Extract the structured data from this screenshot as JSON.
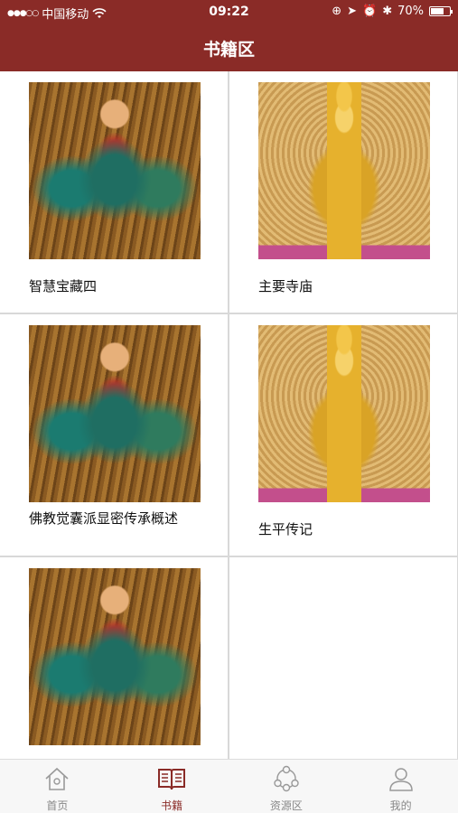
{
  "status_bar": {
    "carrier": "中国移动",
    "time": "09:22",
    "battery": "70%",
    "battery_level": 0.7
  },
  "nav": {
    "title": "书籍区"
  },
  "books": [
    {
      "title": "智慧宝藏四",
      "image": "guardian"
    },
    {
      "title": "主要寺庙",
      "image": "buddha"
    },
    {
      "title": "佛教觉囊派显密传承概述",
      "image": "guardian"
    },
    {
      "title": "生平传记",
      "image": "buddha"
    },
    {
      "title": "",
      "image": "guardian"
    }
  ],
  "tabs": [
    {
      "label": "首页",
      "icon": "home-icon",
      "active": false
    },
    {
      "label": "书籍",
      "icon": "book-icon",
      "active": true
    },
    {
      "label": "资源区",
      "icon": "resources-icon",
      "active": false
    },
    {
      "label": "我的",
      "icon": "user-icon",
      "active": false
    }
  ],
  "colors": {
    "brand": "#8a2b27",
    "tab_inactive": "#888888"
  }
}
